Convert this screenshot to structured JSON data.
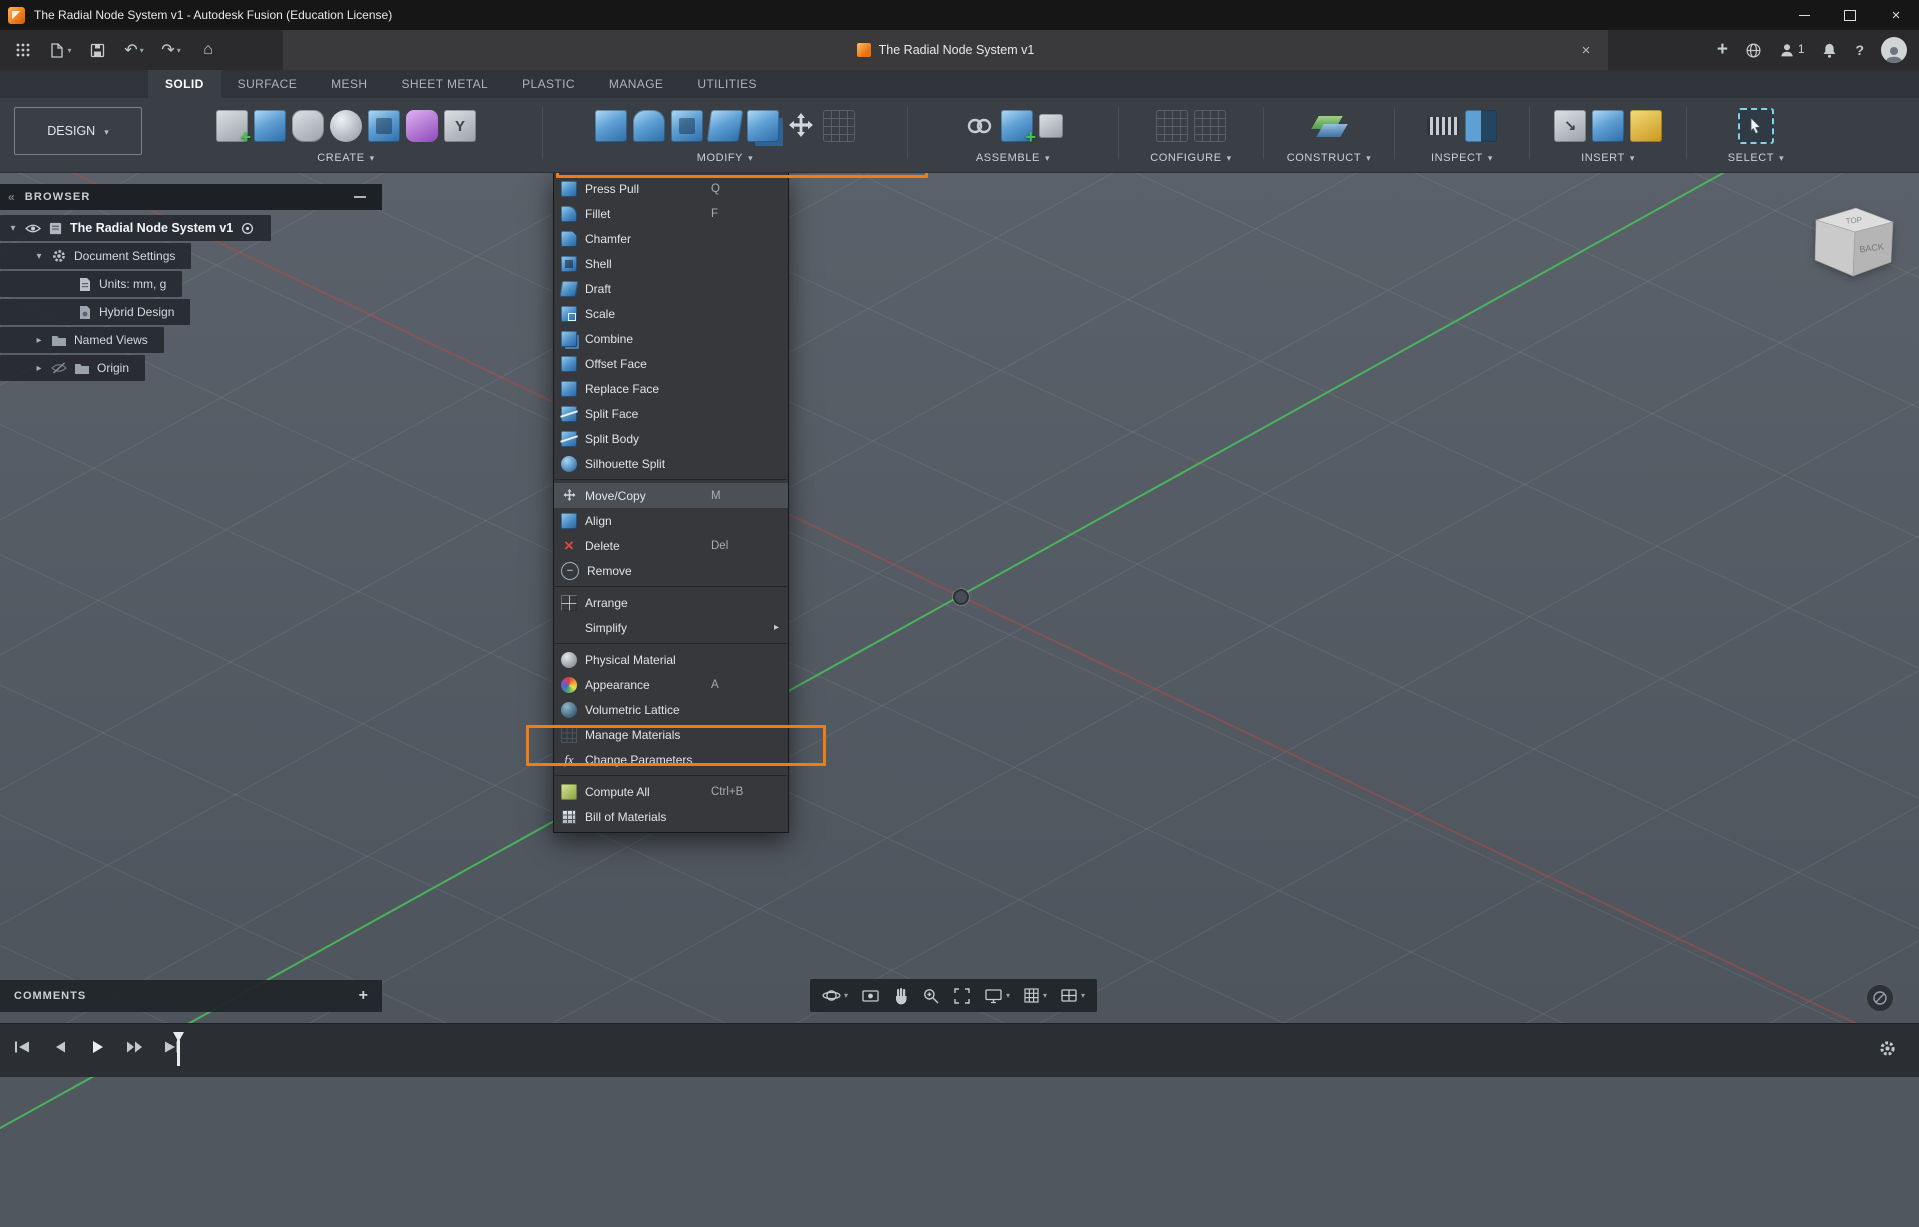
{
  "window": {
    "title": "The Radial Node System v1 - Autodesk Fusion (Education License)"
  },
  "appbar": {
    "doc_tab": "The Radial Node System v1",
    "user_count": "1"
  },
  "ribbon": {
    "design_label": "DESIGN",
    "tabs": [
      {
        "label": "SOLID"
      },
      {
        "label": "SURFACE"
      },
      {
        "label": "MESH"
      },
      {
        "label": "SHEET METAL"
      },
      {
        "label": "PLASTIC"
      },
      {
        "label": "MANAGE"
      },
      {
        "label": "UTILITIES"
      }
    ],
    "groups": [
      "CREATE",
      "MODIFY",
      "ASSEMBLE",
      "CONFIGURE",
      "CONSTRUCT",
      "INSPECT",
      "INSERT",
      "SELECT"
    ]
  },
  "browser": {
    "header": "BROWSER",
    "items": [
      {
        "label": "The Radial Node System v1"
      },
      {
        "label": "Document Settings"
      },
      {
        "label": "Units: mm, g"
      },
      {
        "label": "Hybrid Design"
      },
      {
        "label": "Named Views"
      },
      {
        "label": "Origin"
      }
    ]
  },
  "menu": {
    "items": [
      {
        "label": "Press Pull",
        "shortcut": "Q"
      },
      {
        "label": "Fillet",
        "shortcut": "F"
      },
      {
        "label": "Chamfer"
      },
      {
        "label": "Shell"
      },
      {
        "label": "Draft"
      },
      {
        "label": "Scale"
      },
      {
        "label": "Combine"
      },
      {
        "label": "Offset Face"
      },
      {
        "label": "Replace Face"
      },
      {
        "label": "Split Face"
      },
      {
        "label": "Split Body"
      },
      {
        "label": "Silhouette Split"
      },
      {
        "label": "Move/Copy",
        "shortcut": "M"
      },
      {
        "label": "Align"
      },
      {
        "label": "Delete",
        "shortcut": "Del"
      },
      {
        "label": "Remove"
      },
      {
        "label": "Arrange"
      },
      {
        "label": "Simplify"
      },
      {
        "label": "Physical Material"
      },
      {
        "label": "Appearance",
        "shortcut": "A"
      },
      {
        "label": "Volumetric Lattice"
      },
      {
        "label": "Manage Materials"
      },
      {
        "label": "Change Parameters"
      },
      {
        "label": "Compute All",
        "shortcut": "Ctrl+B"
      },
      {
        "label": "Bill of Materials"
      }
    ]
  },
  "viewcube": {
    "back": "BACK",
    "top": "TOP"
  },
  "comments": {
    "label": "COMMENTS"
  },
  "colors": {
    "annotation_orange": "#f07c15",
    "axis_green": "#4abc5c",
    "axis_red": "#c44a42",
    "icon_blue": "#4a8cc4"
  }
}
